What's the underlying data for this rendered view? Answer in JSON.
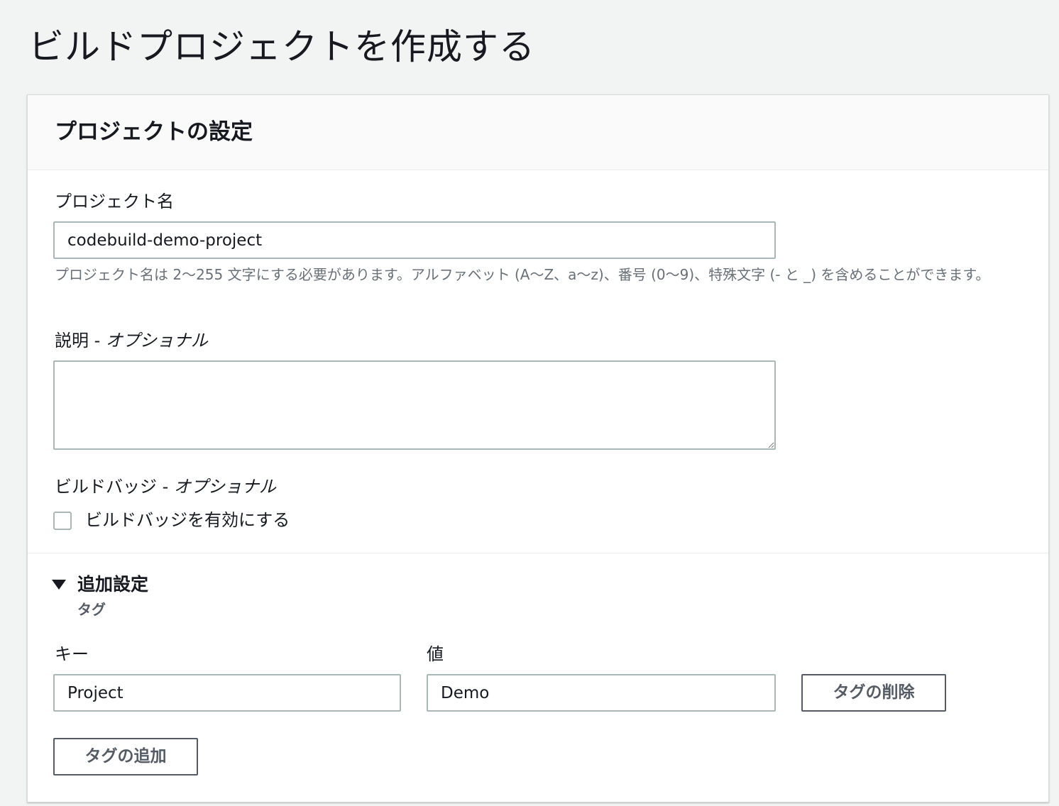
{
  "page": {
    "title": "ビルドプロジェクトを作成する"
  },
  "panel": {
    "title": "プロジェクトの設定",
    "project_name": {
      "label": "プロジェクト名",
      "value": "codebuild-demo-project",
      "hint": "プロジェクト名は 2〜255 文字にする必要があります。アルファベット (A〜Z、a〜z)、番号 (0〜9)、特殊文字 (- と _) を含めることができます。"
    },
    "description": {
      "label": "説明",
      "optional": "オプショナル",
      "separator": " - ",
      "value": ""
    },
    "build_badge": {
      "label": "ビルドバッジ",
      "optional": "オプショナル",
      "separator": " - ",
      "checkbox_label": "ビルドバッジを有効にする",
      "checked": false
    },
    "additional": {
      "toggle_label": "追加設定",
      "tags_heading": "タグ",
      "key_label": "キー",
      "value_label": "値",
      "tag_key": "Project",
      "tag_value": "Demo",
      "remove_tag_label": "タグの削除",
      "add_tag_label": "タグの追加"
    }
  },
  "colors": {
    "background": "#f2f3f3",
    "panel_header": "#fafafa",
    "input_border": "#aab7b8",
    "button_border": "#545b64",
    "hint_text": "#687078"
  }
}
